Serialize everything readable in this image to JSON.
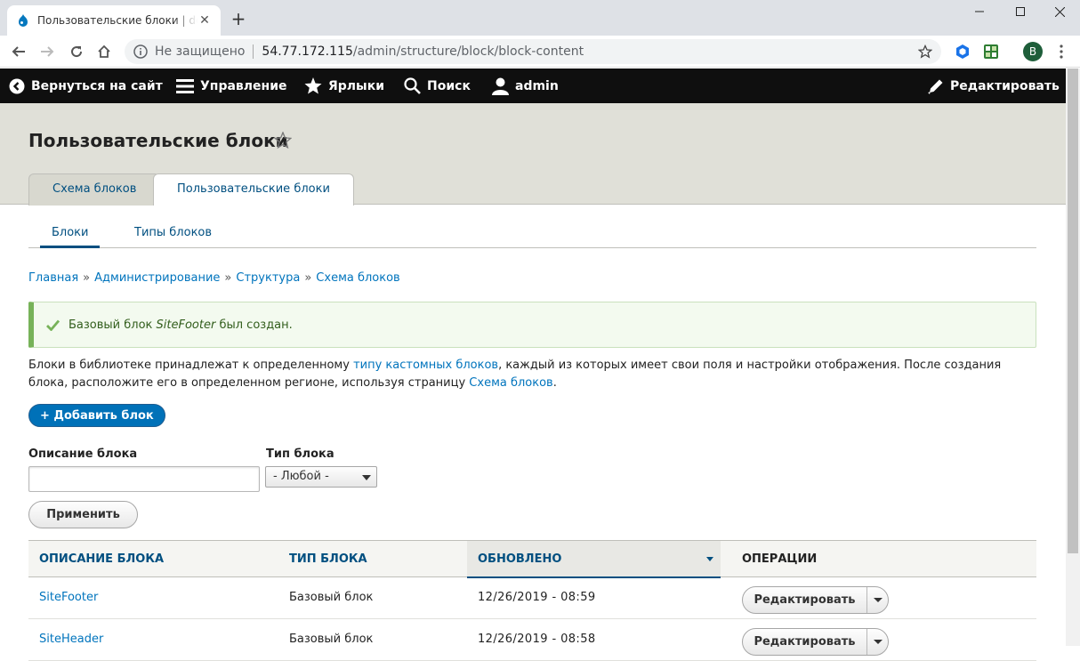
{
  "browser": {
    "tab_title": "Пользовательские блоки | default",
    "security_label": "Не защищено",
    "url_host": "54.77.172.115",
    "url_path": "/admin/structure/block/block-content",
    "profile_initial": "B"
  },
  "admin_toolbar": {
    "back": "Вернуться на сайт",
    "manage": "Управление",
    "shortcuts": "Ярлыки",
    "search": "Поиск",
    "user": "admin",
    "edit": "Редактировать"
  },
  "page": {
    "title": "Пользовательские блоки",
    "primary_tabs": [
      "Схема блоков",
      "Пользовательские блоки"
    ],
    "secondary_tabs": [
      "Блоки",
      "Типы блоков"
    ],
    "breadcrumb": [
      "Главная",
      "Администрирование",
      "Структура",
      "Схема блоков"
    ],
    "message": {
      "before": "Базовый блок ",
      "name": "SiteFooter",
      "after": " был создан."
    },
    "intro": {
      "part1": "Блоки в библиотеке принадлежат к определенному ",
      "link1": "типу кастомных блоков",
      "part2": ", каждый из которых имеет свои поля и настройки отображения. После создания блока, расположите его в определенном регионе, используя страницу ",
      "link2": "Схема блоков",
      "part3": "."
    },
    "add_button": "+ Добавить блок"
  },
  "filters": {
    "description_label": "Описание блока",
    "description_value": "",
    "type_label": "Тип блока",
    "type_selected": "- Любой -",
    "apply": "Применить"
  },
  "table": {
    "headers": [
      "Описание блока",
      "Тип блока",
      "Обновлено",
      "Операции"
    ],
    "rows": [
      {
        "name": "SiteFooter",
        "type": "Базовый блок",
        "updated": "12/26/2019 - 08:59",
        "op": "Редактировать"
      },
      {
        "name": "SiteHeader",
        "type": "Базовый блок",
        "updated": "12/26/2019 - 08:58",
        "op": "Редактировать"
      }
    ]
  },
  "colors": {
    "link": "#0074bd",
    "primary_button": "#0071b8",
    "status_ok": "#77b259",
    "toolbar_bg": "#0f0f0f"
  }
}
